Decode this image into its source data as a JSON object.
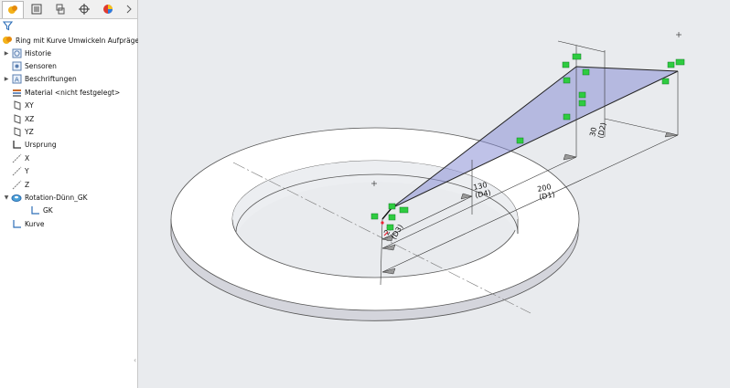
{
  "tabs": [
    {
      "id": "feature-manager",
      "icon": "feature-manager-icon"
    },
    {
      "id": "property-manager",
      "icon": "property-manager-icon"
    },
    {
      "id": "configuration-manager",
      "icon": "configuration-manager-icon"
    },
    {
      "id": "dimxpert",
      "icon": "dimxpert-icon"
    },
    {
      "id": "display-manager",
      "icon": "display-manager-icon"
    }
  ],
  "tree": {
    "root": "Ring mit Kurve Umwickeln Aufprägen",
    "items": [
      {
        "label": "Historie",
        "icon": "history-icon",
        "expandable": true
      },
      {
        "label": "Sensoren",
        "icon": "sensor-icon",
        "expandable": false
      },
      {
        "label": "Beschriftungen",
        "icon": "annotations-icon",
        "expandable": true
      },
      {
        "label": "Material <nicht festgelegt>",
        "icon": "material-icon",
        "expandable": false
      },
      {
        "label": "XY",
        "icon": "plane-icon",
        "expandable": false
      },
      {
        "label": "XZ",
        "icon": "plane-icon",
        "expandable": false
      },
      {
        "label": "YZ",
        "icon": "plane-icon",
        "expandable": false
      },
      {
        "label": "Ursprung",
        "icon": "origin-icon",
        "expandable": false
      },
      {
        "label": "X",
        "icon": "axis-icon",
        "expandable": false
      },
      {
        "label": "Y",
        "icon": "axis-icon",
        "expandable": false
      },
      {
        "label": "Z",
        "icon": "axis-icon",
        "expandable": false
      },
      {
        "label": "Rotation-Dünn_GK",
        "icon": "revolve-icon",
        "expandable": true,
        "expanded": true
      },
      {
        "label": "GK",
        "icon": "sketch-icon",
        "expandable": false,
        "child": true
      },
      {
        "label": "Kurve",
        "icon": "sketch-icon",
        "expandable": false
      }
    ]
  },
  "viewport": {
    "dimensions": [
      {
        "value": "20",
        "name": "(D3)"
      },
      {
        "value": "130",
        "name": "(D4)"
      },
      {
        "value": "200",
        "name": "(D1)"
      },
      {
        "value": "30",
        "name": "(D2)"
      }
    ]
  },
  "colors": {
    "sketch_fill": "#8a8fd6",
    "relation_green": "#2ecc40",
    "background": "#e9ebee"
  }
}
